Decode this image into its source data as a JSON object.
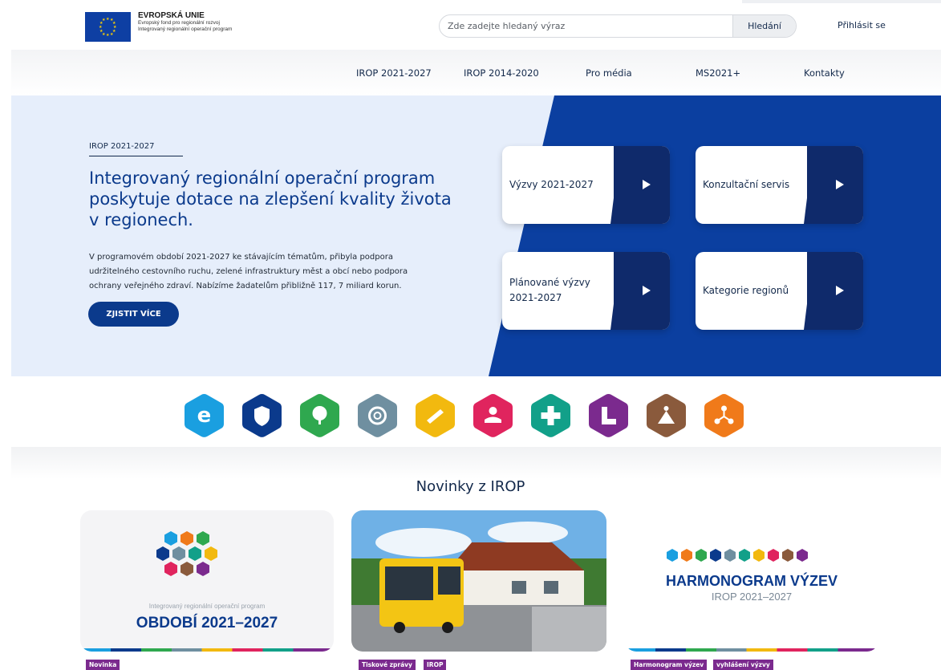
{
  "header": {
    "eu_title": "EVROPSKÁ UNIE",
    "eu_line1": "Evropský fond pro regionální rozvoj",
    "eu_line2": "Integrovaný regionální operační program",
    "search_placeholder": "Zde zadejte hledaný výraz",
    "search_button": "Hledání",
    "login": "Přihlásit se"
  },
  "nav": {
    "items": [
      "IROP 2021-2027",
      "IROP 2014-2020",
      "Pro média",
      "MS2021+",
      "Kontakty"
    ]
  },
  "hero": {
    "tag": "IROP 2021-2027",
    "title": "Integrovaný regionální operační program poskytuje dotace na zlepšení kvality života v regionech.",
    "text": "V programovém období 2021-2027 ke stávajícím tématům, přibyla podpora udržitelného cestovního ruchu, zelené infrastruktury měst a obcí nebo podpora ochrany veřejného zdraví. Nabízíme žadatelům přibližně 117, 7 miliard korun.",
    "button": "ZJISTIT VÍCE",
    "tiles": [
      {
        "label": "Výzvy 2021-2027"
      },
      {
        "label": "Konzultační servis"
      },
      {
        "label": "Plánované výzvy 2021-2027"
      },
      {
        "label": "Kategorie regionů"
      }
    ]
  },
  "icons": [
    {
      "name": "e-government-icon",
      "color": "#1a9fe0"
    },
    {
      "name": "security-shield-icon",
      "color": "#0b3a8c"
    },
    {
      "name": "green-tree-icon",
      "color": "#2fa84f"
    },
    {
      "name": "integrated-tools-icon",
      "color": "#6f8fa0"
    },
    {
      "name": "transport-icon",
      "color": "#f2b90f"
    },
    {
      "name": "social-inclusion-icon",
      "color": "#e0245e"
    },
    {
      "name": "health-cross-icon",
      "color": "#12a089"
    },
    {
      "name": "education-icon",
      "color": "#7b2a8e"
    },
    {
      "name": "culture-tourism-icon",
      "color": "#8a5a3c"
    },
    {
      "name": "network-icon",
      "color": "#f07a1a"
    }
  ],
  "news": {
    "title": "Novinky z IROP",
    "cards": [
      {
        "caption": "Integrovaný regionální operační program",
        "headline": "OBDOBÍ 2021–2027",
        "tags": [
          "Novinka"
        ]
      },
      {
        "tags": [
          "Tiskové zprávy",
          "IROP"
        ]
      },
      {
        "headline": "HARMONOGRAM VÝZEV",
        "subheadline": "IROP 2021–2027",
        "tags": [
          "Harmonogram výzev",
          "vyhlášení výzvy"
        ]
      }
    ]
  }
}
